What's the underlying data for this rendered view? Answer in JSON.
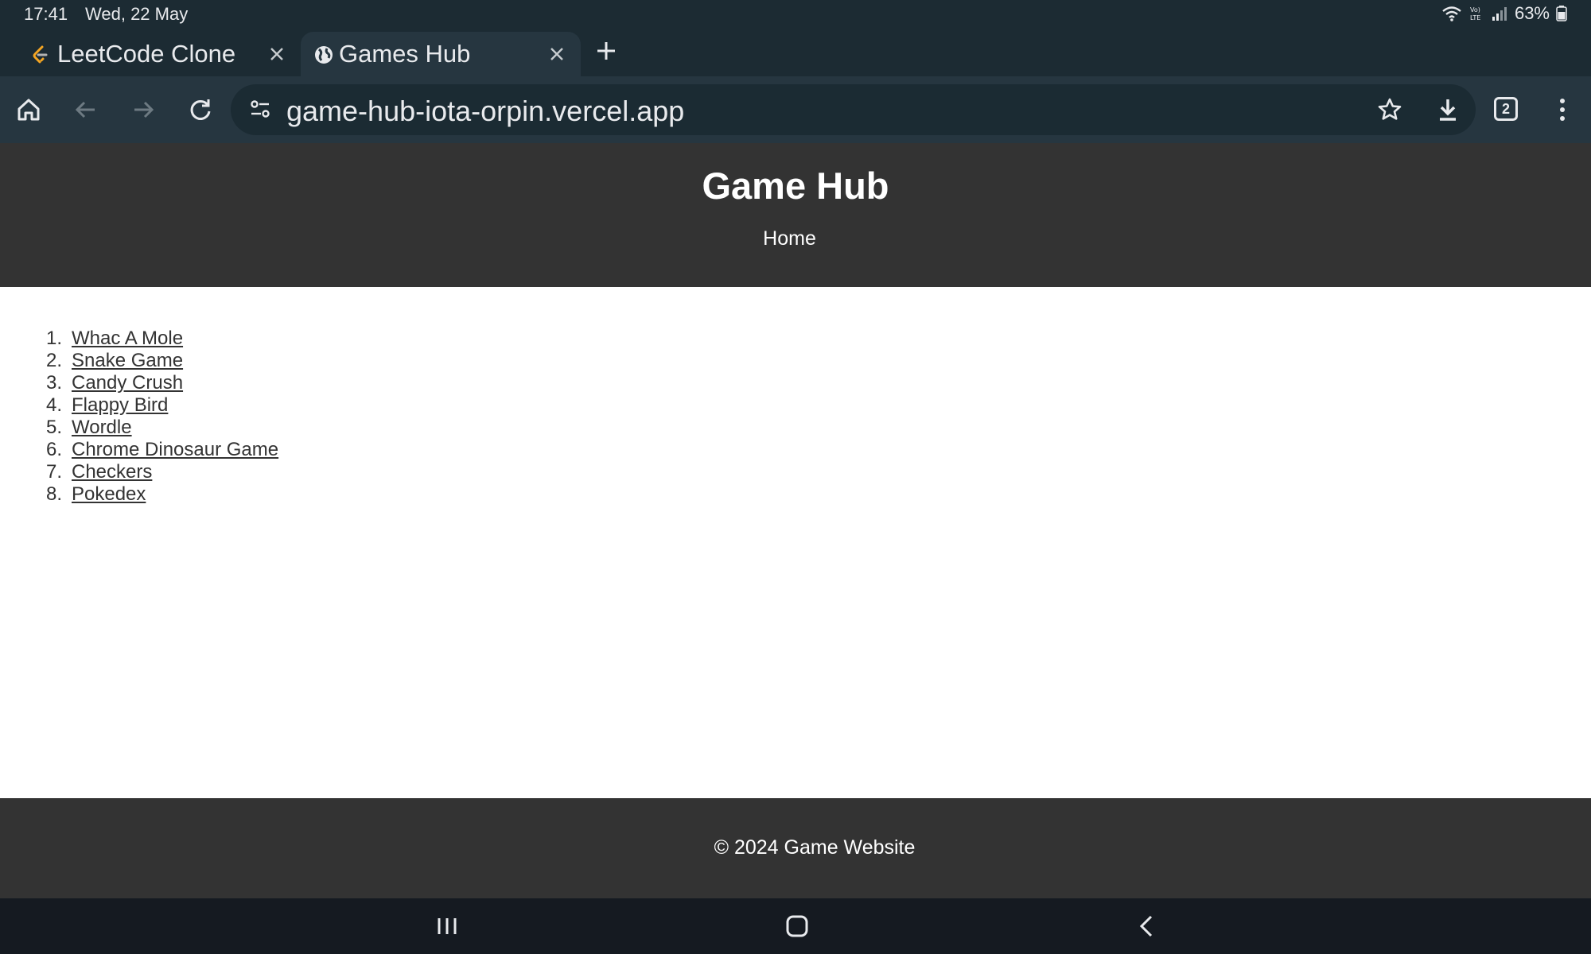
{
  "status_bar": {
    "time": "17:41",
    "date": "Wed, 22 May",
    "battery": "63%",
    "icons": [
      "wifi-icon",
      "volte-icon",
      "signal-icon",
      "battery-icon"
    ]
  },
  "tabs": [
    {
      "title": "LeetCode Clone",
      "favicon": "leetcode-favicon",
      "active": false
    },
    {
      "title": "Games Hub",
      "favicon": "globe-icon",
      "active": true
    }
  ],
  "toolbar": {
    "url": "game-hub-iota-orpin.vercel.app",
    "tab_count": "2"
  },
  "page": {
    "title": "Game Hub",
    "nav_home": "Home",
    "games": [
      {
        "num": "1.",
        "label": "Whac A Mole"
      },
      {
        "num": "2.",
        "label": "Snake Game"
      },
      {
        "num": "3.",
        "label": "Candy Crush"
      },
      {
        "num": "4.",
        "label": "Flappy Bird"
      },
      {
        "num": "5.",
        "label": "Wordle"
      },
      {
        "num": "6.",
        "label": "Chrome Dinosaur Game"
      },
      {
        "num": "7.",
        "label": "Checkers"
      },
      {
        "num": "8.",
        "label": "Pokedex"
      }
    ],
    "footer": "© 2024 Game Website"
  },
  "colors": {
    "chrome_bg": "#1c2b33",
    "toolbar_bg": "#263640",
    "site_header_bg": "#333333",
    "nav_bar_bg": "#151a21"
  }
}
